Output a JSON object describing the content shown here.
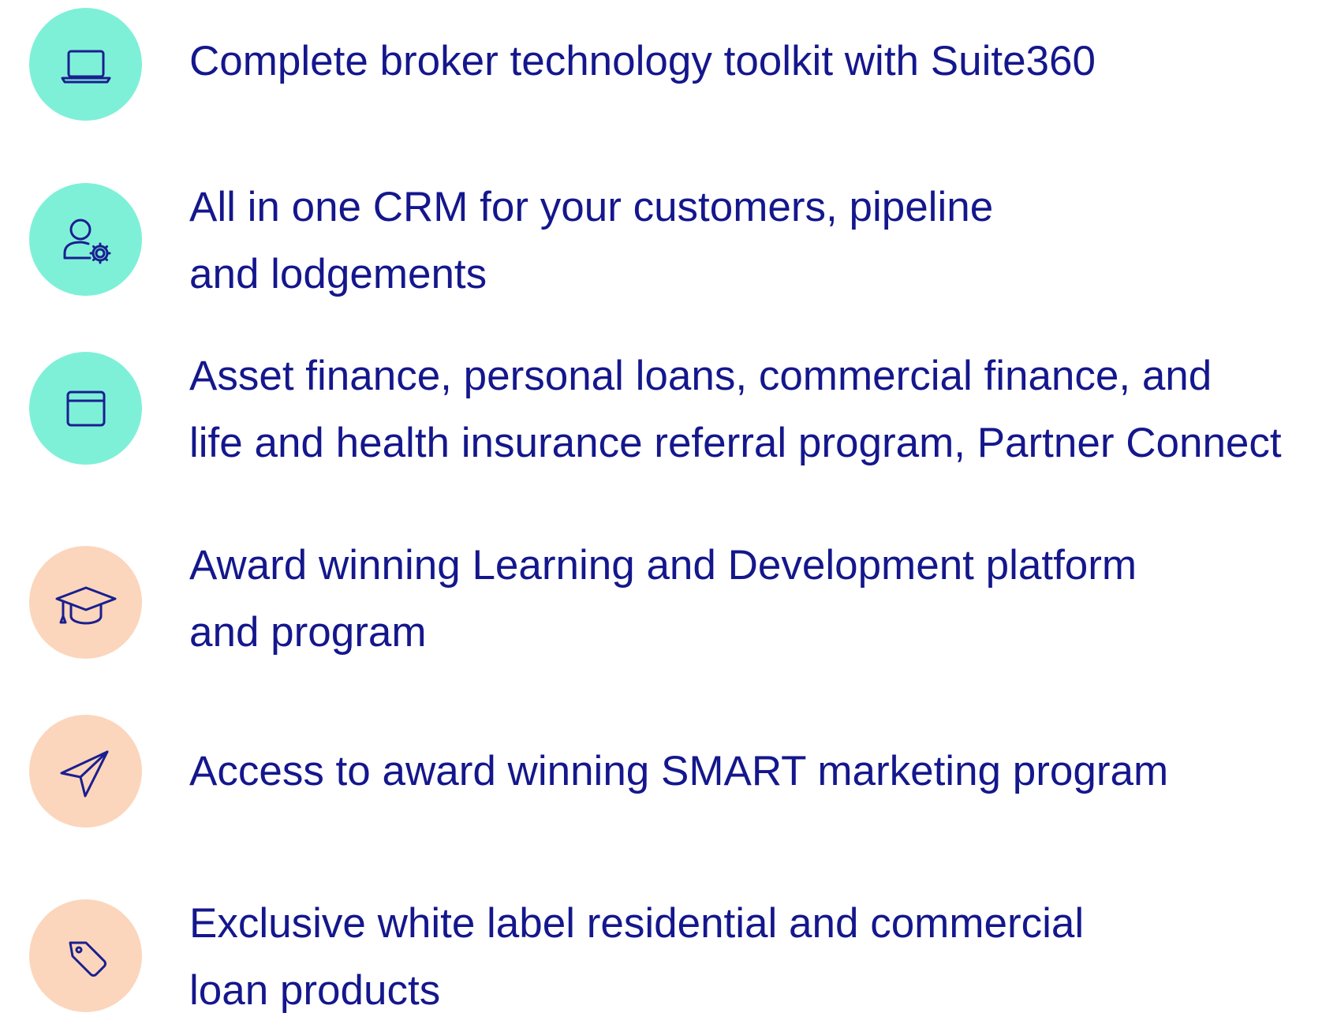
{
  "features": [
    {
      "icon": "laptop-icon",
      "color": "#7ff0d8",
      "lines": [
        "Complete broker technology toolkit with Suite360"
      ]
    },
    {
      "icon": "user-gear-icon",
      "color": "#7ff0d8",
      "lines": [
        "All in one CRM for your customers, pipeline",
        "and lodgements"
      ]
    },
    {
      "icon": "browser-window-icon",
      "color": "#7ff0d8",
      "lines": [
        "Asset finance, personal loans, commercial finance, and",
        "life and health insurance referral program, Partner Connect"
      ]
    },
    {
      "icon": "graduation-cap-icon",
      "color": "#fbd6bc",
      "lines": [
        "Award winning Learning and Development platform",
        "and program"
      ]
    },
    {
      "icon": "paper-plane-icon",
      "color": "#fbd6bc",
      "lines": [
        "Access to award winning SMART marketing program"
      ]
    },
    {
      "icon": "price-tag-icon",
      "color": "#fbd6bc",
      "lines": [
        "Exclusive white label residential and commercial",
        "loan products"
      ]
    }
  ],
  "text_color": "#14178c",
  "icon_stroke_color": "#1a1f8f"
}
